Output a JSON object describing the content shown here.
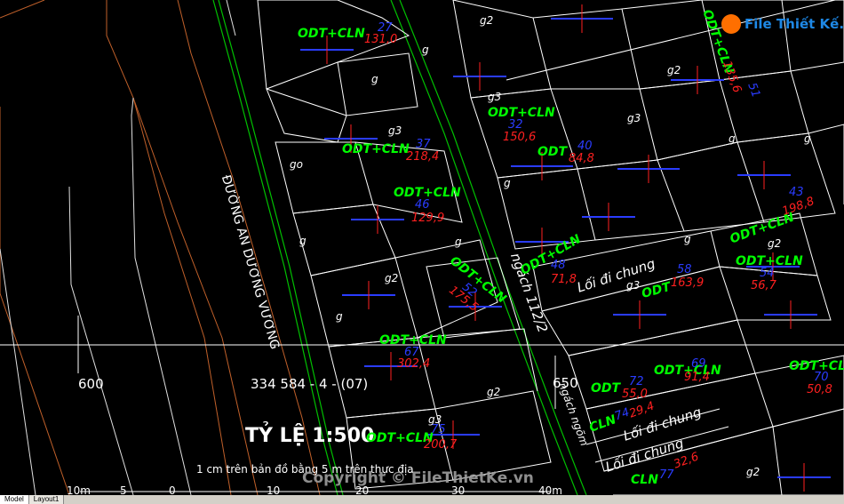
{
  "app": {
    "layout_tabs": [
      "Model",
      "Layout1"
    ]
  },
  "logo": {
    "text": "File Thiết Kế.vn"
  },
  "watermark": {
    "text": "Copyright © FileThietKe.vn"
  },
  "street": {
    "name": "ĐƯỜNG AN DƯƠNG VƯƠNG"
  },
  "grid_labels": {
    "left": "600",
    "right": "650",
    "sheet_code": "334 584 - 4 - (07)"
  },
  "scale": {
    "title": "TỶ LỆ 1:500",
    "note": "1 cm trên bản đồ bằng 5 m trên thực địa",
    "bar_labels": [
      "10m",
      "5",
      "0",
      "10",
      "20",
      "30",
      "40m"
    ]
  },
  "alleys": {
    "ngach": "ngách 112/2",
    "ngach_lower": "ngách ngõm",
    "common_path": "Lối đi chung"
  },
  "parcels": [
    {
      "land_use": "ODT+CLN",
      "number": "27",
      "area": "131,0"
    },
    {
      "land_use": "ODT+CLN",
      "number": "37",
      "area": "218,4"
    },
    {
      "land_use": "ODT+CLN",
      "number": "46",
      "area": "129,9"
    },
    {
      "land_use": "ODT+CLN",
      "number": "52",
      "area": "175,5"
    },
    {
      "land_use": "ODT+CLN",
      "number": "67",
      "area": "302,4"
    },
    {
      "land_use": "ODT+CLN",
      "number": "75",
      "area": "200,7"
    },
    {
      "land_use": "ODT+CLN",
      "number": "32",
      "area": "150,6"
    },
    {
      "land_use": "ODT",
      "number": "40",
      "area": "84,8"
    },
    {
      "land_use": "ODT+CLN",
      "number": "48",
      "area": "71,8"
    },
    {
      "land_use": "ODT",
      "number": "58",
      "area": "163,9"
    },
    {
      "land_use": "ODT+CLN",
      "number": "43",
      "area": "198,8"
    },
    {
      "land_use": "ODT+CLN",
      "number": "54",
      "area": "56,7"
    },
    {
      "land_use": "ODT",
      "number": "72",
      "area": "55,0"
    },
    {
      "land_use": "CLN",
      "number": "74",
      "area": "29,4"
    },
    {
      "land_use": "ODT+CLN",
      "number": "69",
      "area": "91,4"
    },
    {
      "land_use": "ODT+CLN",
      "number": "70",
      "area": "50,8"
    },
    {
      "land_use": "CLN",
      "number": "77",
      "area": "32,6"
    },
    {
      "land_use": "ODT+CLN",
      "number": "51",
      "area": "135,6"
    }
  ],
  "class_labels": [
    "g",
    "g2",
    "g3",
    "go"
  ],
  "colors": {
    "land_use": "#00ff00",
    "area": "#ff2020",
    "number": "#2a3cff",
    "parcel_line": "#ffffff",
    "road_edge": "#00c000",
    "boundary": "#c0602a",
    "marker": "#2a3cff",
    "marker_center": "#ff2020"
  }
}
